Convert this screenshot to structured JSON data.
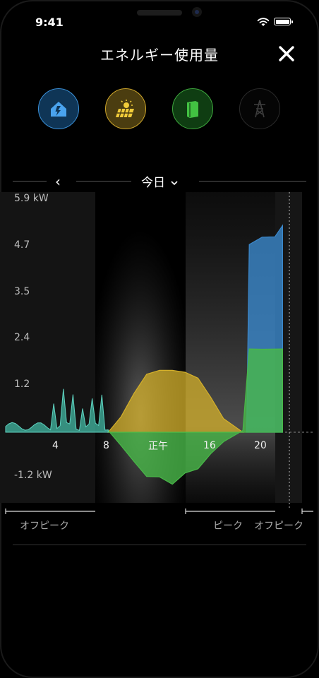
{
  "status": {
    "time": "9:41"
  },
  "header": {
    "title": "エネルギー使用量"
  },
  "sources": [
    {
      "name": "home",
      "color": "#3a8fd6"
    },
    {
      "name": "solar",
      "color": "#d8b22a"
    },
    {
      "name": "powerwall",
      "color": "#45b045"
    },
    {
      "name": "grid",
      "color": "#444444"
    }
  ],
  "nav": {
    "prev": "‹",
    "day": "今日"
  },
  "chart_data": {
    "type": "area",
    "y_ticks": [
      "5.9 kW",
      "4.7",
      "3.5",
      "2.4",
      "1.2",
      "-1.2 kW"
    ],
    "x_ticks": [
      "4",
      "8",
      "正午",
      "16",
      "20"
    ],
    "ylim": [
      -1.8,
      5.9
    ],
    "xlim": [
      0,
      24
    ],
    "series": [
      {
        "name": "",
        "color": "#d4b02a",
        "x": [
          8,
          9,
          10,
          11,
          12,
          13,
          14,
          15,
          16,
          17,
          18.5
        ],
        "y": [
          0,
          0.4,
          1,
          1.5,
          1.6,
          1.6,
          1.55,
          1.4,
          0.9,
          0.35,
          0
        ]
      },
      {
        "name": "",
        "color": "#3b88cc",
        "x": [
          18.8,
          19,
          20,
          21,
          21.6
        ],
        "y": [
          0,
          4.9,
          5.0,
          5.1,
          5.3
        ]
      },
      {
        "name": "",
        "color": "#48b848",
        "x": [
          8,
          9,
          10,
          11,
          12,
          13,
          14,
          15,
          16,
          17,
          18.5,
          19,
          20,
          21.6
        ],
        "y": [
          0,
          -0.3,
          -0.8,
          -1.1,
          -1.2,
          -1.3,
          -1.1,
          -0.9,
          -0.6,
          -0.2,
          0,
          2.2,
          2.1,
          2.2
        ]
      }
    ]
  },
  "periods": {
    "offpeak1": "オフピーク",
    "peak": "ピーク",
    "offpeak2": "オフピーク"
  }
}
